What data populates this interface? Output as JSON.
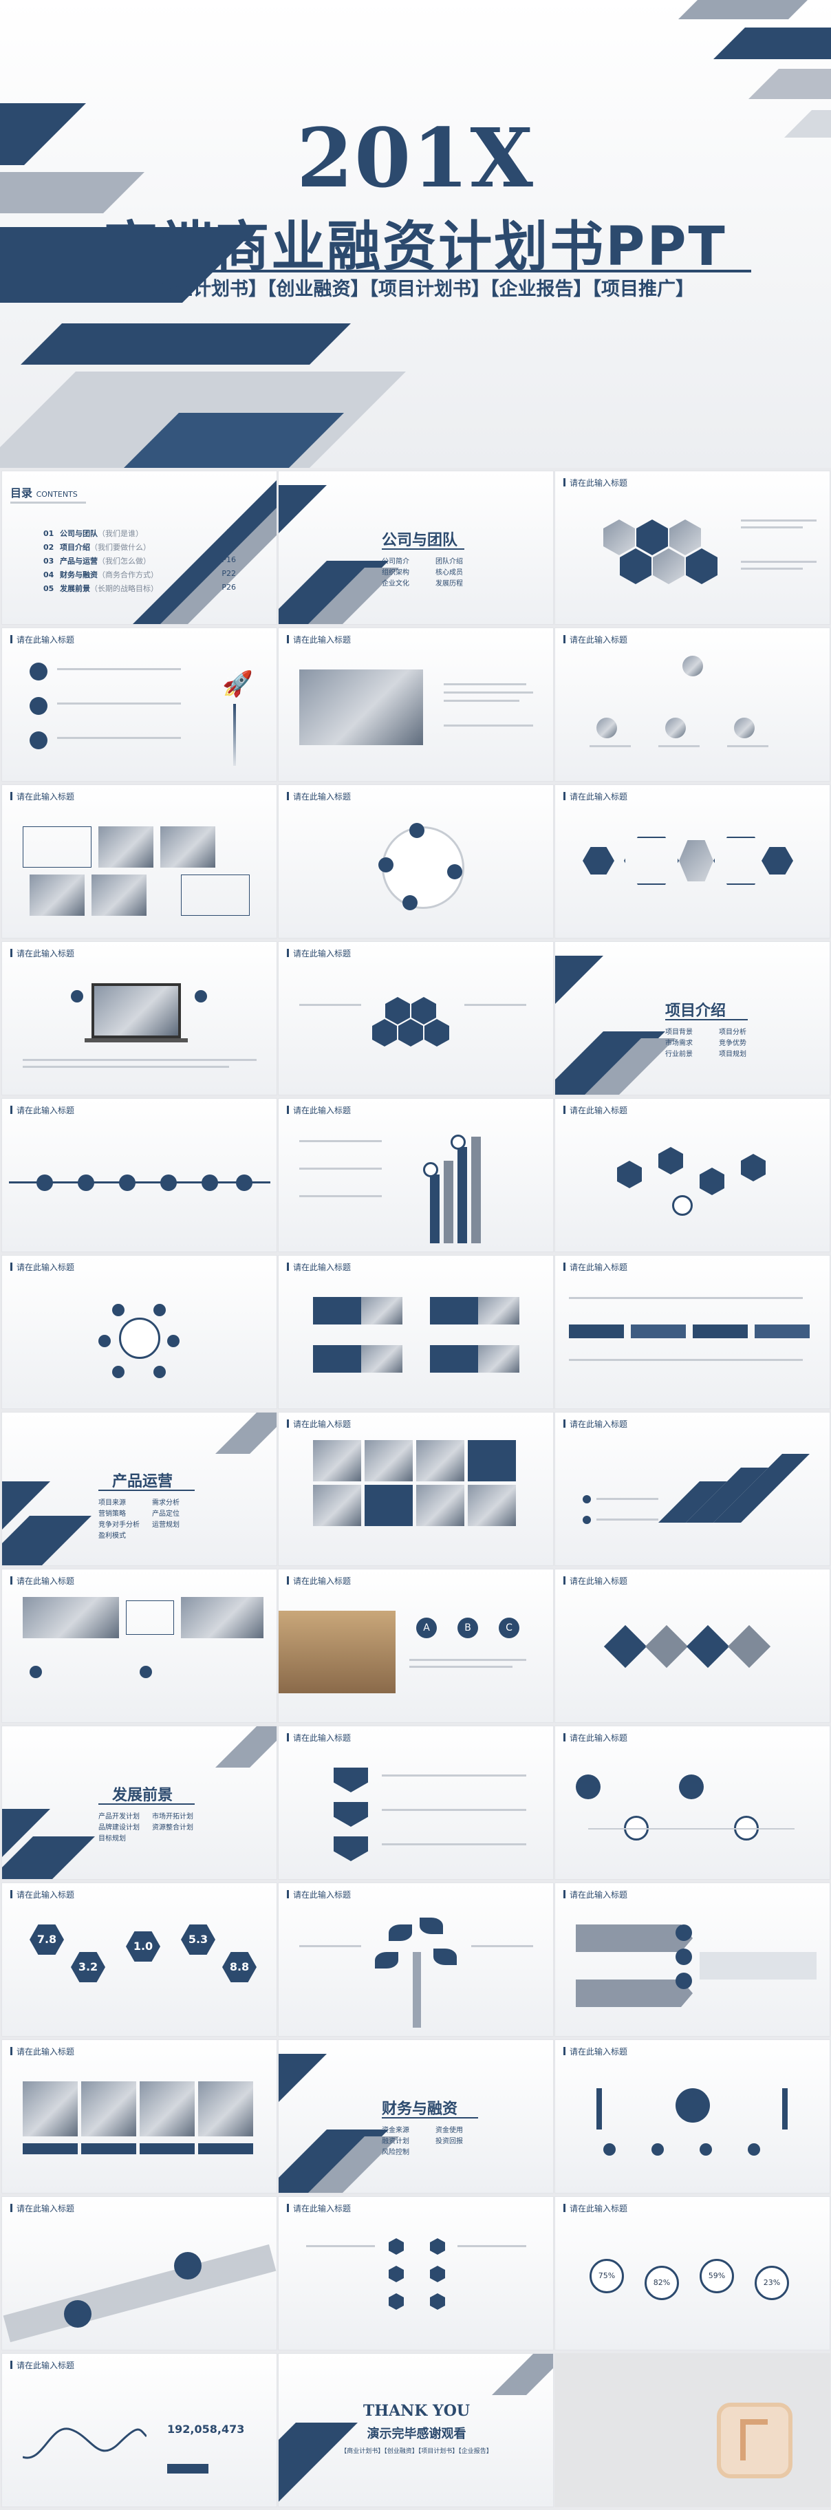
{
  "hero": {
    "year": "201X",
    "title": "高端商业融资计划书PPT",
    "tags": "【商业计划书】【创业融资】【项目计划书】【企业报告】【项目推广】"
  },
  "placeholder_title": "请在此输入标题",
  "toc": {
    "heading": "目录",
    "heading_en": "CONTENTS",
    "items": [
      {
        "num": "01",
        "label": "公司与团队",
        "sub": "（我们是谁）",
        "page": "P4"
      },
      {
        "num": "02",
        "label": "项目介绍",
        "sub": "（我们要做什么）",
        "page": "P9"
      },
      {
        "num": "03",
        "label": "产品与运营",
        "sub": "（我们怎么做）",
        "page": "P16"
      },
      {
        "num": "04",
        "label": "财务与融资",
        "sub": "（商务合作方式）",
        "page": "P22"
      },
      {
        "num": "05",
        "label": "发展前景",
        "sub": "（长期的战略目标）",
        "page": "P26"
      }
    ]
  },
  "sections": {
    "company": {
      "title": "公司与团队",
      "items": [
        "公司简介",
        "团队介绍",
        "组织架构",
        "核心成员",
        "企业文化",
        "发展历程"
      ]
    },
    "project": {
      "title": "项目介绍",
      "items": [
        "项目背景",
        "项目分析",
        "市场需求",
        "竞争优势",
        "行业前景",
        "项目规划"
      ]
    },
    "product": {
      "title": "产品运营",
      "items": [
        "项目来源",
        "需求分析",
        "营销策略",
        "产品定位",
        "竞争对手分析",
        "运营规划",
        "盈利模式"
      ]
    },
    "future": {
      "title": "发展前景",
      "items": [
        "产品开发计划",
        "市场开拓计划",
        "品牌建设计划",
        "资源整合计划",
        "目标规划"
      ]
    },
    "finance": {
      "title": "财务与融资",
      "items": [
        "资金来源",
        "资金使用",
        "融资计划",
        "投资回报",
        "风险控制"
      ]
    }
  },
  "stats": {
    "numbers": [
      "7.8",
      "3.2",
      "1.0",
      "5.3",
      "8.8"
    ],
    "percents": [
      "75%",
      "82%",
      "59%",
      "23%"
    ],
    "total": "192,058,473"
  },
  "abc": [
    "A",
    "B",
    "C"
  ],
  "thanks": {
    "en": "THANK YOU",
    "cn": "演示完毕感谢观看",
    "tags": "【商业计划书】【创业融资】【项目计划书】【企业报告】"
  }
}
